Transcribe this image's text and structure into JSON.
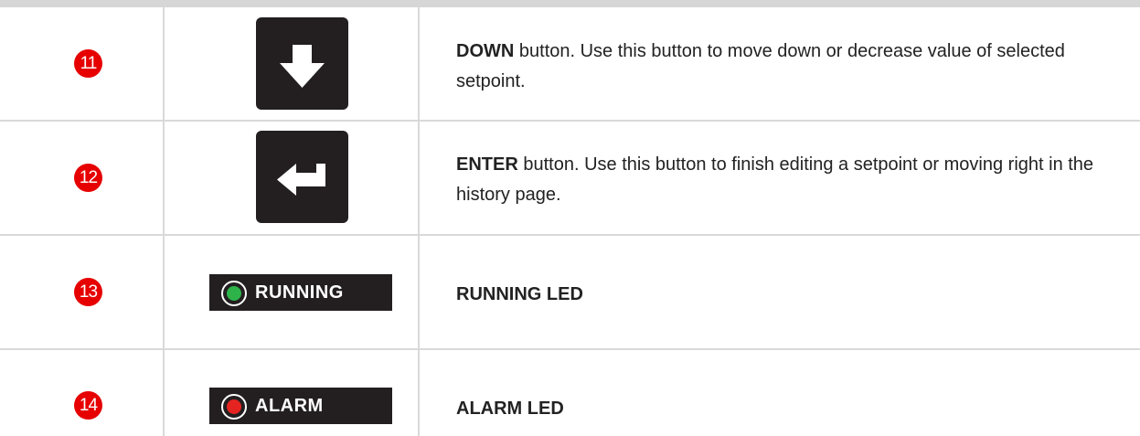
{
  "rows": [
    {
      "number": "11",
      "icon": "down-arrow-icon",
      "title": "DOWN",
      "text": " button. Use this button to move down or decrease value of selected setpoint."
    },
    {
      "number": "12",
      "icon": "enter-return-icon",
      "title": "ENTER",
      "text": " button. Use this button to finish editing a setpoint or moving right in the history page."
    },
    {
      "number": "13",
      "led_label": "RUNNING",
      "led_color": "#2db34a",
      "title": "RUNNING LED",
      "text": ""
    },
    {
      "number": "14",
      "led_label": "ALARM",
      "led_color": "#e52421",
      "title": "ALARM LED",
      "text": ""
    }
  ],
  "colors": {
    "badge": "#e60000",
    "button_bg": "#231f20",
    "grid": "#d9d9d9"
  }
}
